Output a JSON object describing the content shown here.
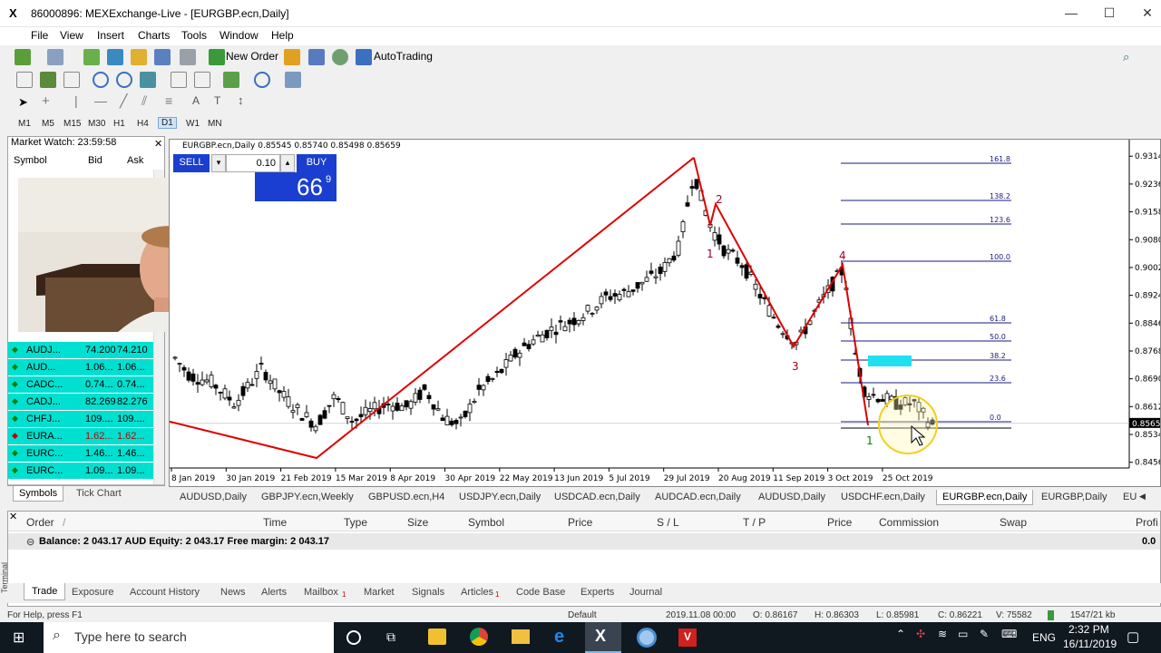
{
  "window": {
    "title": "86000896: MEXExchange-Live - [EURGBP.ecn,Daily]",
    "controls": [
      "—",
      "☐",
      "✕"
    ]
  },
  "menu": [
    "File",
    "View",
    "Insert",
    "Charts",
    "Tools",
    "Window",
    "Help"
  ],
  "toolbar": {
    "new_order": "New Order",
    "autotrading": "AutoTrading"
  },
  "timeframes": [
    "M1",
    "M5",
    "M15",
    "M30",
    "H1",
    "H4",
    "D1",
    "W1",
    "MN"
  ],
  "market_watch": {
    "title": "Market Watch: 23:59:58",
    "columns": [
      "Symbol",
      "Bid",
      "Ask"
    ],
    "rows": [
      {
        "symbol": "AUDJ...",
        "bid": "74.200",
        "ask": "74.210",
        "dir": "up"
      },
      {
        "symbol": "AUD...",
        "bid": "1.06...",
        "ask": "1.06...",
        "dir": "up"
      },
      {
        "symbol": "CADC...",
        "bid": "0.74...",
        "ask": "0.74...",
        "dir": "up"
      },
      {
        "symbol": "CADJ...",
        "bid": "82.269",
        "ask": "82.276",
        "dir": "up"
      },
      {
        "symbol": "CHFJ...",
        "bid": "109....",
        "ask": "109....",
        "dir": "up"
      },
      {
        "symbol": "EURA...",
        "bid": "1.62...",
        "ask": "1.62...",
        "dir": "down"
      },
      {
        "symbol": "EURC...",
        "bid": "1.46...",
        "ask": "1.46...",
        "dir": "up"
      },
      {
        "symbol": "EURC...",
        "bid": "1.09...",
        "ask": "1.09...",
        "dir": "up"
      }
    ],
    "tabs": [
      "Symbols",
      "Tick Chart"
    ]
  },
  "chart": {
    "header": "EURGBP.ecn,Daily  0.85545 0.85740 0.85498 0.85659",
    "sell": "SELL",
    "buy": "BUY",
    "lot": "0.10",
    "buy_price": "66",
    "buy_price_sup": "9",
    "price_axis": [
      "0.9314",
      "0.9236",
      "0.9158",
      "0.9080",
      "0.9002",
      "0.8924",
      "0.8846",
      "0.8768",
      "0.8690",
      "0.8612",
      "0.8534",
      "0.8456"
    ],
    "current_price": "0.8565",
    "date_axis": [
      "8 Jan 2019",
      "30 Jan 2019",
      "21 Feb 2019",
      "15 Mar 2019",
      "8 Apr 2019",
      "30 Apr 2019",
      "22 May 2019",
      "13 Jun 2019",
      "5 Jul 2019",
      "29 Jul 2019",
      "20 Aug 2019",
      "11 Sep 2019",
      "3 Oct 2019",
      "25 Oct 2019"
    ],
    "fib_levels": [
      "161.8",
      "138.2",
      "123.6",
      "100.0",
      "61.8",
      "50.0",
      "38.2",
      "23.6",
      "0.0"
    ],
    "wave_labels": [
      "1",
      "2",
      "3",
      "4",
      "1"
    ]
  },
  "chart_tabs": [
    "AUDUSD,Daily",
    "GBPJPY.ecn,Weekly",
    "GBPUSD.ecn,H4",
    "USDJPY.ecn,Daily",
    "USDCAD.ecn,Daily",
    "AUDCAD.ecn,Daily",
    "AUDUSD,Daily",
    "USDCHF.ecn,Daily",
    "EURGBP.ecn,Daily",
    "EURGBP,Daily",
    "EU"
  ],
  "terminal": {
    "columns": [
      "Order",
      "/",
      "Time",
      "Type",
      "Size",
      "Symbol",
      "Price",
      "S / L",
      "T / P",
      "Price",
      "Commission",
      "Swap",
      "Profi"
    ],
    "balance": "Balance: 2 043.17 AUD  Equity: 2 043.17  Free margin: 2 043.17",
    "balance_profit": "0.0",
    "tabs": [
      "Trade",
      "Exposure",
      "Account History",
      "News",
      "Alerts",
      "Mailbox",
      "Market",
      "Signals",
      "Articles",
      "Code Base",
      "Experts",
      "Journal"
    ],
    "mailbox_badge": "1",
    "articles_badge": "1",
    "side_label": "Terminal"
  },
  "statusbar": {
    "help": "For Help, press F1",
    "profile": "Default",
    "time": "2019.11.08 00:00",
    "o": "O: 0.86167",
    "h": "H: 0.86303",
    "l": "L: 0.85981",
    "c": "C: 0.86221",
    "v": "V: 75582",
    "kb": "1547/21 kb"
  },
  "taskbar": {
    "search_placeholder": "Type here to search",
    "lang": "ENG",
    "time": "2:32 PM",
    "date": "16/11/2019"
  },
  "colors": {
    "market_row": "#00e0d0",
    "trade_button": "#1a3fd0",
    "wave_line": "#e00000",
    "fib_line": "#1a1a80"
  }
}
